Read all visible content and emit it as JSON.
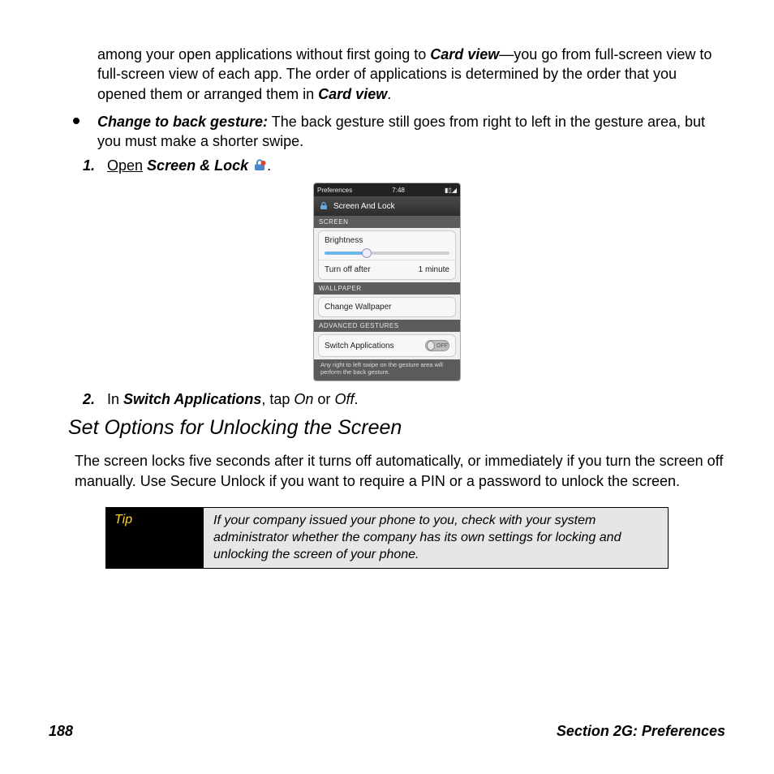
{
  "intro": {
    "part1": "among your open applications without first going to ",
    "cardview": "Card view",
    "part2": "—you go from full-screen view to full-screen view of each app. The order of applications is determined by the order that you opened them or arranged them in ",
    "cardview2": "Card view",
    "part3": "."
  },
  "bullet": {
    "label": "Change to back gesture:",
    "text": " The back gesture still goes from right to left in the gesture area, but you must make a shorter swipe."
  },
  "step1": {
    "num": "1.",
    "open": "Open",
    "app": " Screen & Lock ",
    "period": "."
  },
  "phone": {
    "status_left": "Preferences",
    "status_time": "7:48",
    "header": "Screen And Lock",
    "sec_screen": "SCREEN",
    "brightness": "Brightness",
    "turnoff_label": "Turn off after",
    "turnoff_value": "1 minute",
    "sec_wallpaper": "WALLPAPER",
    "change_wallpaper": "Change Wallpaper",
    "sec_gestures": "ADVANCED GESTURES",
    "switch_apps": "Switch Applications",
    "toggle_state": "OFF",
    "hint": "Any right to left swipe on the gesture area will perform the back gesture."
  },
  "step2": {
    "num": "2.",
    "t1": "In ",
    "switch": "Switch Applications",
    "t2": ", tap ",
    "on": "On",
    "t3": " or ",
    "off": "Off",
    "t4": "."
  },
  "section_title": "Set Options for Unlocking the Screen",
  "body": "The screen locks five seconds after it turns off automatically, or immediately if you turn the screen off manually. Use Secure Unlock if you want to require a PIN or a password to unlock the screen.",
  "tip": {
    "label": "Tip",
    "text": "If your company issued your phone to you, check with your system administrator whether the company has its own settings for locking and unlocking the screen of your phone."
  },
  "footer": {
    "page": "188",
    "section": "Section 2G: Preferences"
  }
}
